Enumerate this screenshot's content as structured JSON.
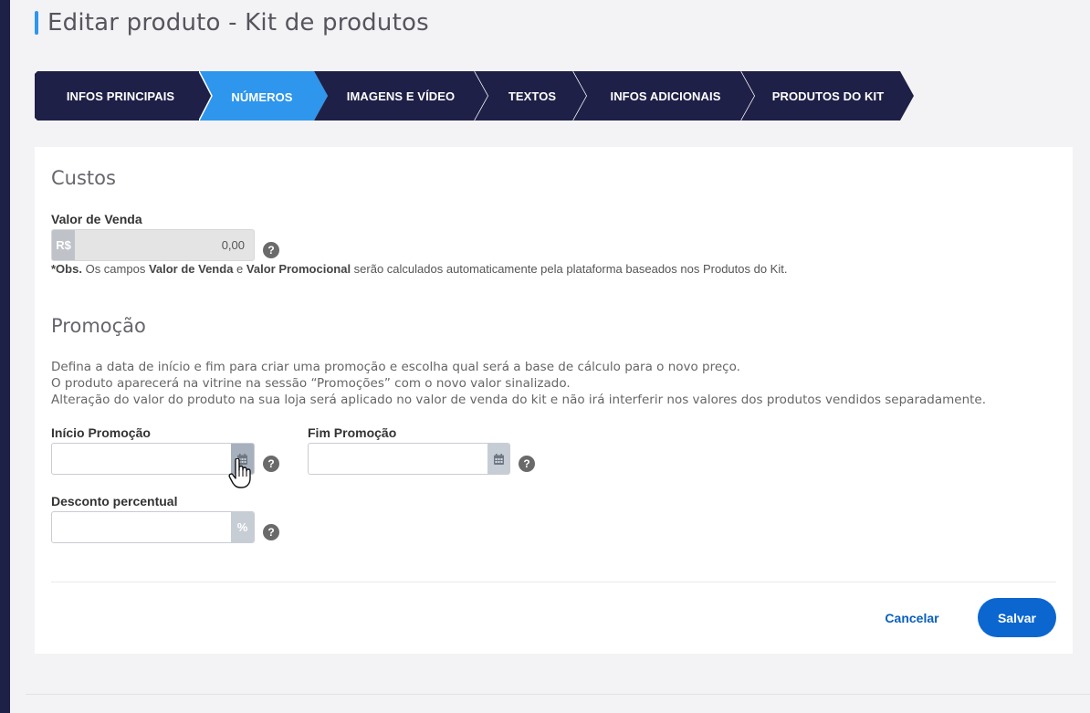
{
  "page": {
    "title": "Editar produto - Kit de produtos"
  },
  "tabs": [
    {
      "label": "INFOS PRINCIPAIS",
      "active": false
    },
    {
      "label": "NÚMEROS",
      "active": true
    },
    {
      "label": "IMAGENS E VÍDEO",
      "active": false
    },
    {
      "label": "TEXTOS",
      "active": false
    },
    {
      "label": "INFOS ADICIONAIS",
      "active": false
    },
    {
      "label": "PRODUTOS DO KIT",
      "active": false
    }
  ],
  "custos": {
    "title": "Custos",
    "valor_venda_label": "Valor de Venda",
    "currency_prefix": "R$",
    "valor_venda_value": "0,00",
    "obs_prefix": "*Obs.",
    "obs_text1": " Os campos ",
    "obs_bold1": "Valor de Venda",
    "obs_text2": " e ",
    "obs_bold2": "Valor Promocional",
    "obs_text3": " serão calculados automaticamente pela plataforma baseados nos Produtos do Kit."
  },
  "promocao": {
    "title": "Promoção",
    "desc_line1": "Defina a data de início e fim para criar uma promoção e escolha qual será a base de cálculo para o novo preço.",
    "desc_line2": "O produto aparecerá na vitrine na sessão “Promoções” com o novo valor sinalizado.",
    "desc_line3": "Alteração do valor do produto na sua loja será aplicado no valor de venda do kit e não irá interferir nos valores dos produtos vendidos separadamente.",
    "inicio_label": "Início Promoção",
    "inicio_value": "",
    "fim_label": "Fim Promoção",
    "fim_value": "",
    "desconto_label": "Desconto percentual",
    "desconto_value": "",
    "percent_suffix": "%"
  },
  "help_glyph": "?",
  "actions": {
    "cancel_label": "Cancelar",
    "save_label": "Salvar"
  },
  "colors": {
    "sidebar": "#1f2047",
    "tab_dark": "#1f2047",
    "tab_active": "#2e96ec",
    "primary_button": "#0b66d0",
    "link": "#0a5fbf"
  },
  "icons": {
    "calendar": "calendar-icon",
    "help": "help-icon",
    "cursor": "hand-pointer-icon"
  }
}
